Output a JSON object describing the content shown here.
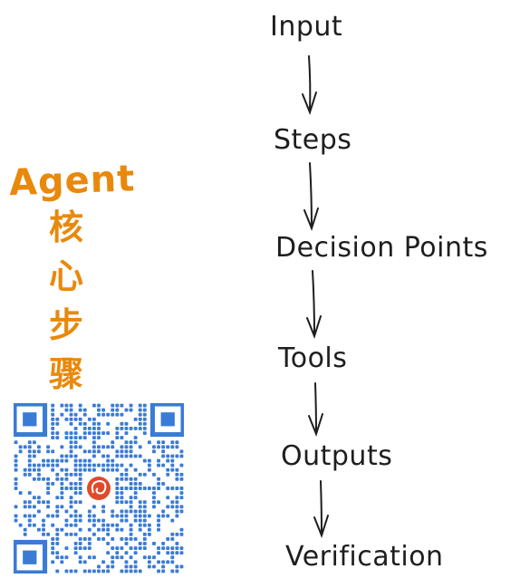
{
  "title": {
    "en": "Agent",
    "cn": [
      "核",
      "心",
      "步",
      "骤"
    ]
  },
  "steps": [
    {
      "label": "Input"
    },
    {
      "label": "Steps"
    },
    {
      "label": "Decision Points"
    },
    {
      "label": "Tools"
    },
    {
      "label": "Outputs"
    },
    {
      "label": "Verification"
    }
  ],
  "colors": {
    "title": "#e8890c",
    "text": "#1e1e1e",
    "qr": "#3a7bd5",
    "qr_logo": "#e04a2a"
  },
  "icons": [
    "qr-code-icon",
    "logo-icon"
  ]
}
